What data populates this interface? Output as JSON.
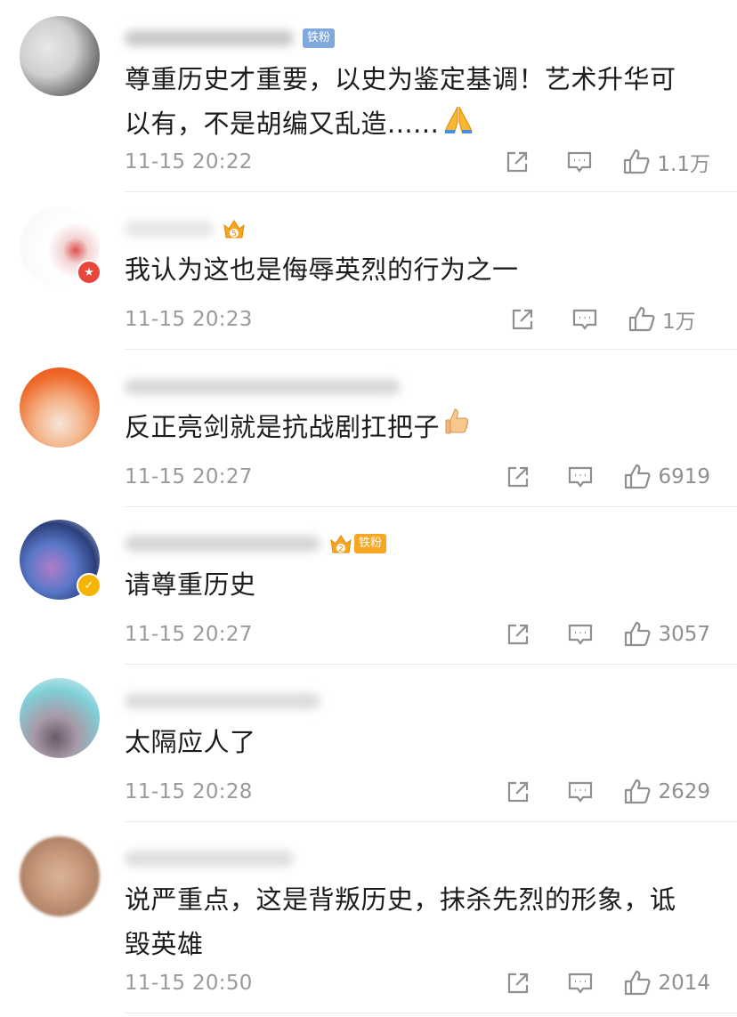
{
  "comments": [
    {
      "name_badge": "铁粉",
      "badge_color": "#7fa9dc",
      "text": "尊重历史才重要，以史为鉴定基调！艺术升华可以有，不是胡编又乱造......",
      "emoji": "folded-hands",
      "time": "11-15 20:22",
      "likes": "1.1万"
    },
    {
      "crown_level": "5",
      "text": "我认为这也是侮辱英烈的行为之一",
      "time": "11-15 20:23",
      "likes": "1万"
    },
    {
      "text": "反正亮剑就是抗战剧扛把子",
      "emoji": "thumbs-up",
      "time": "11-15 20:27",
      "likes": "6919"
    },
    {
      "crown_level": "2",
      "name_badge": "铁粉",
      "badge_color": "#f5a623",
      "text": "请尊重历史",
      "time": "11-15 20:27",
      "likes": "3057"
    },
    {
      "text": "太隔应人了",
      "time": "11-15 20:28",
      "likes": "2629"
    },
    {
      "text": "说严重点，这是背叛历史，抹杀先烈的形象，诋毁英雄",
      "time": "11-15 20:50",
      "likes": "2014"
    }
  ],
  "icons": {
    "share": "share-icon",
    "comment": "comment-icon",
    "like": "like-icon"
  },
  "colors": {
    "text": "#1c1c1c",
    "meta": "#9a9a9a",
    "icon": "#8f8f8f",
    "divider": "#ececec",
    "crown": "#f5a623"
  }
}
